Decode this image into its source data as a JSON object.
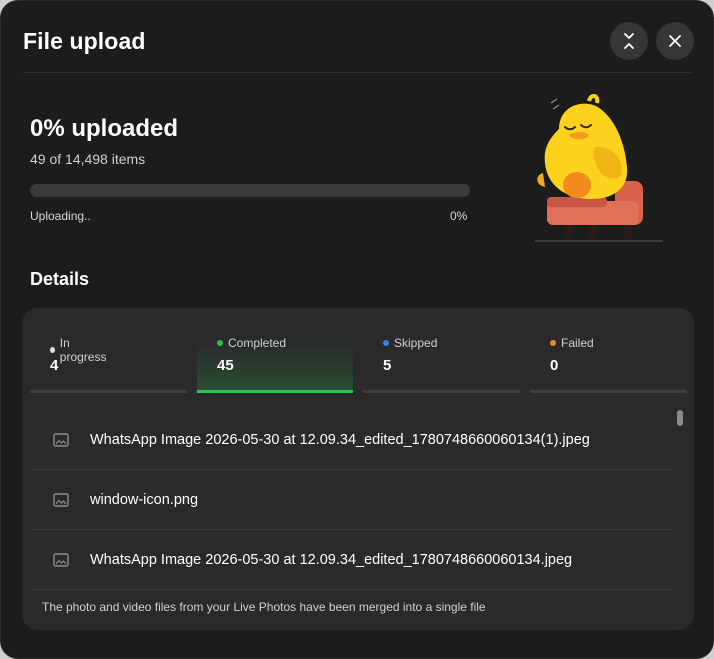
{
  "dialog": {
    "title": "File upload",
    "collapse_icon": "collapse-icon",
    "close_icon": "close-icon"
  },
  "progress": {
    "heading": "0% uploaded",
    "items": "49 of 14,498 items",
    "status": "Uploading..",
    "percent_label": "0%",
    "fraction": 0,
    "color": "#22b14c"
  },
  "details": {
    "heading": "Details",
    "tabs": [
      {
        "label": "In progress",
        "count": "4",
        "dot_color": "#e0e0e0"
      },
      {
        "label": "Completed",
        "count": "45",
        "dot_color": "#22c44f"
      },
      {
        "label": "Skipped",
        "count": "5",
        "dot_color": "#2f86f0"
      },
      {
        "label": "Failed",
        "count": "0",
        "dot_color": "#f08a24"
      }
    ],
    "active_tab": "Completed",
    "files": [
      {
        "name": "WhatsApp Image 2026-05-30 at 12.09.34_edited_1780748660060134(1).jpeg",
        "icon": "image-icon"
      },
      {
        "name": "window-icon.png",
        "icon": "image-icon"
      },
      {
        "name": "WhatsApp Image 2026-05-30 at 12.09.34_edited_1780748660060134.jpeg",
        "icon": "image-icon"
      }
    ],
    "note": "The photo and video files from your Live Photos have been merged into a single file"
  }
}
